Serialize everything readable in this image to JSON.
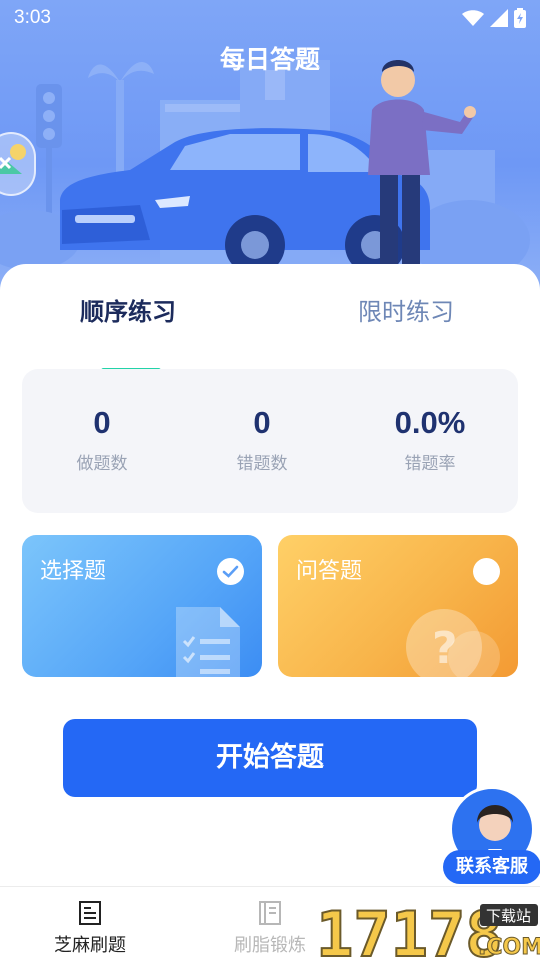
{
  "status_bar": {
    "time": "3:03"
  },
  "header": {
    "title": "每日答题"
  },
  "tabs": [
    {
      "label": "顺序练习",
      "active": true
    },
    {
      "label": "限时练习",
      "active": false
    }
  ],
  "stats": [
    {
      "value": "0",
      "label": "做题数"
    },
    {
      "value": "0",
      "label": "错题数"
    },
    {
      "value": "0.0%",
      "label": "错题率"
    }
  ],
  "question_types": [
    {
      "label": "选择题",
      "selected": true
    },
    {
      "label": "问答题",
      "selected": false
    }
  ],
  "start_button": {
    "label": "开始答题"
  },
  "service": {
    "label": "联系客服"
  },
  "bottom_nav": [
    {
      "label": "芝麻刷题",
      "active": true,
      "icon": "document-icon"
    },
    {
      "label": "刷脂锻炼",
      "active": false,
      "icon": "notebook-icon"
    }
  ],
  "watermark": {
    "number": "17178",
    "badge": "下载站",
    "suffix": ".COM"
  },
  "colors": {
    "accent": "#2468f5",
    "indicator": "#22d3a8",
    "choice_card": "#56a6f8",
    "answer_card": "#f8b54b"
  }
}
